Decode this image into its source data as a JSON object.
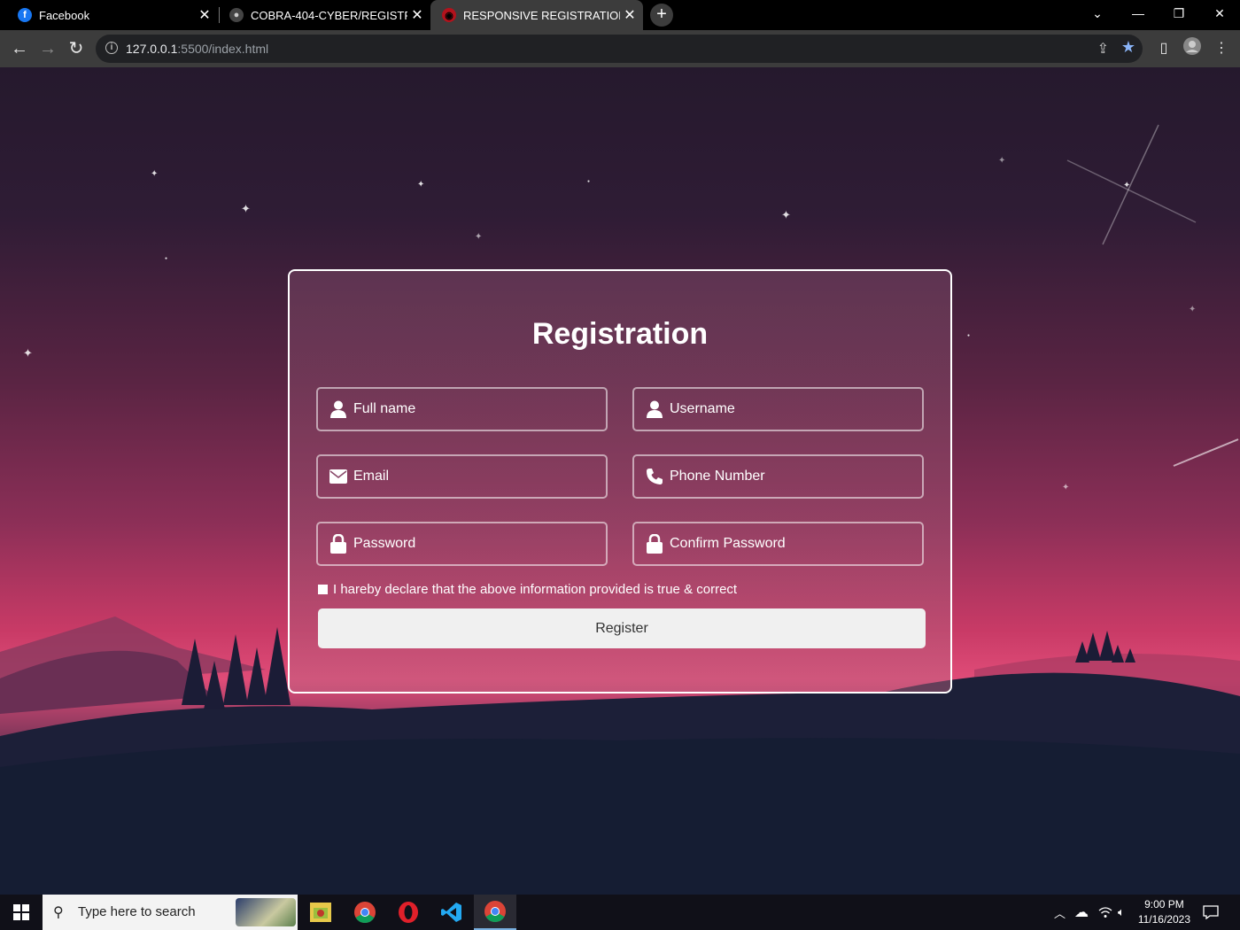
{
  "browser": {
    "tabs": [
      {
        "title": "Facebook",
        "icon": "facebook-icon",
        "active": false
      },
      {
        "title": "COBRA-404-CYBER/REGISTRATIC",
        "icon": "github-icon",
        "active": false
      },
      {
        "title": "RESPONSIVE REGISTRATION FOI",
        "icon": "sharingan-icon",
        "active": true
      }
    ],
    "new_tab": "+",
    "url_host": "127.0.0.1",
    "url_rest": ":5500/index.html"
  },
  "form": {
    "title": "Registration",
    "fields": [
      {
        "placeholder": "Full name",
        "icon": "user-icon"
      },
      {
        "placeholder": "Username",
        "icon": "user-icon"
      },
      {
        "placeholder": "Email",
        "icon": "envelope-icon"
      },
      {
        "placeholder": "Phone Number",
        "icon": "phone-icon"
      },
      {
        "placeholder": "Password",
        "icon": "lock-icon"
      },
      {
        "placeholder": "Confirm Password",
        "icon": "lock-icon"
      }
    ],
    "declaration": "I hareby declare that the above information provided is true & correct",
    "register_label": "Register"
  },
  "taskbar": {
    "search_placeholder": "Type here to search",
    "time": "9:00 PM",
    "date": "11/16/2023",
    "apps": [
      "file-explorer-icon",
      "chrome-icon",
      "opera-icon",
      "vscode-icon",
      "chrome-icon"
    ]
  },
  "colors": {
    "card_border": "#ffffff",
    "button_bg": "#f0f0f0",
    "star_active": "#8ab4f8"
  }
}
